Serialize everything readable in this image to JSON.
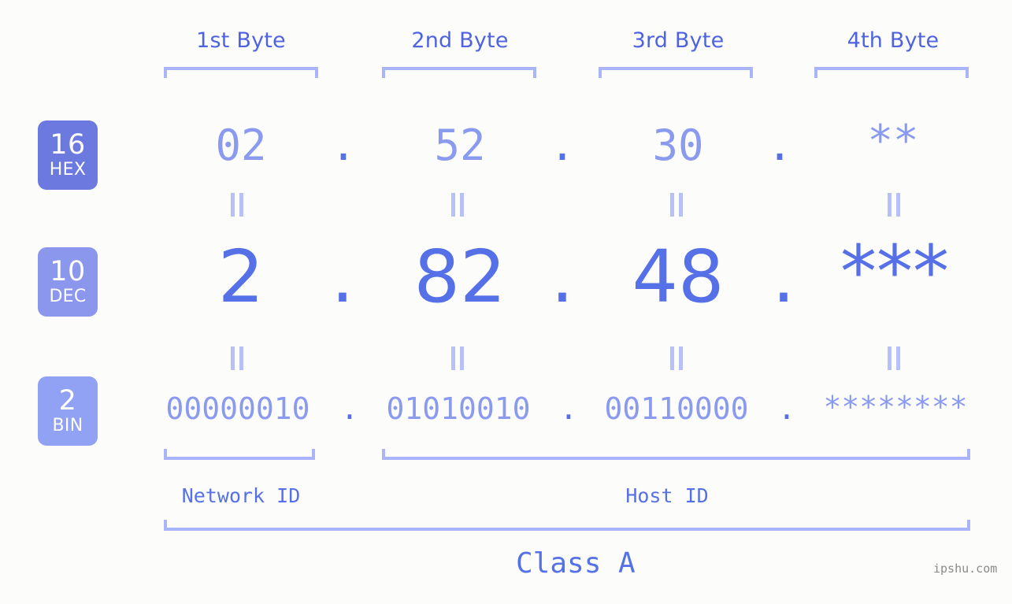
{
  "meta": {
    "background": "#fcfdfa",
    "accent_strong": "#5670e8",
    "accent_light": "#8a9aef",
    "bracket_color": "#aab4fb",
    "eq_color": "#b8c1f7",
    "watermark_color": "#8a8a8a"
  },
  "byte_headers": [
    {
      "label": "1st Byte"
    },
    {
      "label": "2nd Byte"
    },
    {
      "label": "3rd Byte"
    },
    {
      "label": "4th Byte"
    }
  ],
  "bases": [
    {
      "number": "16",
      "name": "HEX",
      "color": "#6c7ae0"
    },
    {
      "number": "10",
      "name": "DEC",
      "color": "#8a97ec"
    },
    {
      "number": "2",
      "name": "BIN",
      "color": "#91a1f3"
    }
  ],
  "rows": {
    "hex": {
      "base_number": "16",
      "base_name": "HEX",
      "values": [
        "02",
        "52",
        "30",
        "**"
      ],
      "separators": [
        ".",
        ".",
        "."
      ]
    },
    "dec": {
      "base_number": "10",
      "base_name": "DEC",
      "values": [
        "2",
        "82",
        "48",
        "***"
      ],
      "separators": [
        ".",
        ".",
        "."
      ]
    },
    "bin": {
      "base_number": "2",
      "base_name": "BIN",
      "values": [
        "00000010",
        "01010010",
        "00110000",
        "********"
      ],
      "separators": [
        ".",
        ".",
        "."
      ]
    }
  },
  "equality_marks": {
    "symbol": "=",
    "count_per_gap": 4
  },
  "segments": {
    "network_id": "Network ID",
    "host_id": "Host ID",
    "class": "Class A"
  },
  "watermark": "ipshu.com"
}
